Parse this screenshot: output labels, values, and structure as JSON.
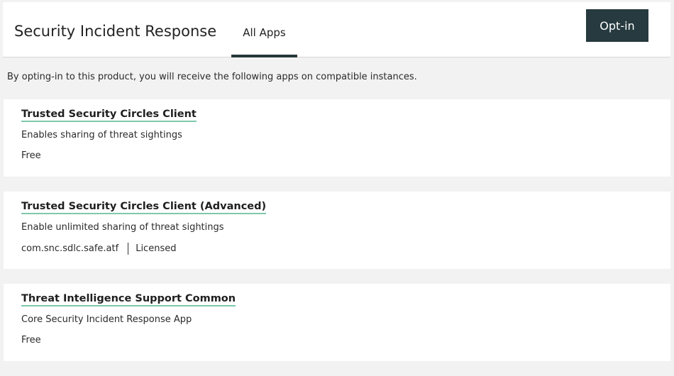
{
  "header": {
    "title": "Security Incident Response",
    "tabs": [
      {
        "label": "All Apps",
        "active": true
      }
    ],
    "optin_label": "Opt-in"
  },
  "intro_text": "By opting-in to this product, you will receive the following apps on compatible instances.",
  "apps": [
    {
      "name": "Trusted Security Circles Client",
      "description": "Enables sharing of threat sightings",
      "price": "Free"
    },
    {
      "name": "Trusted Security Circles Client (Advanced)",
      "description": "Enable unlimited sharing of threat sightings",
      "scope": "com.snc.sdlc.safe.atf",
      "price": "Licensed"
    },
    {
      "name": "Threat Intelligence Support Common",
      "description": "Core Security Incident Response App",
      "price": "Free"
    }
  ],
  "colors": {
    "primary": "#263a3f",
    "link_underline": "#7fc8a9",
    "background": "#f2f2f2"
  }
}
